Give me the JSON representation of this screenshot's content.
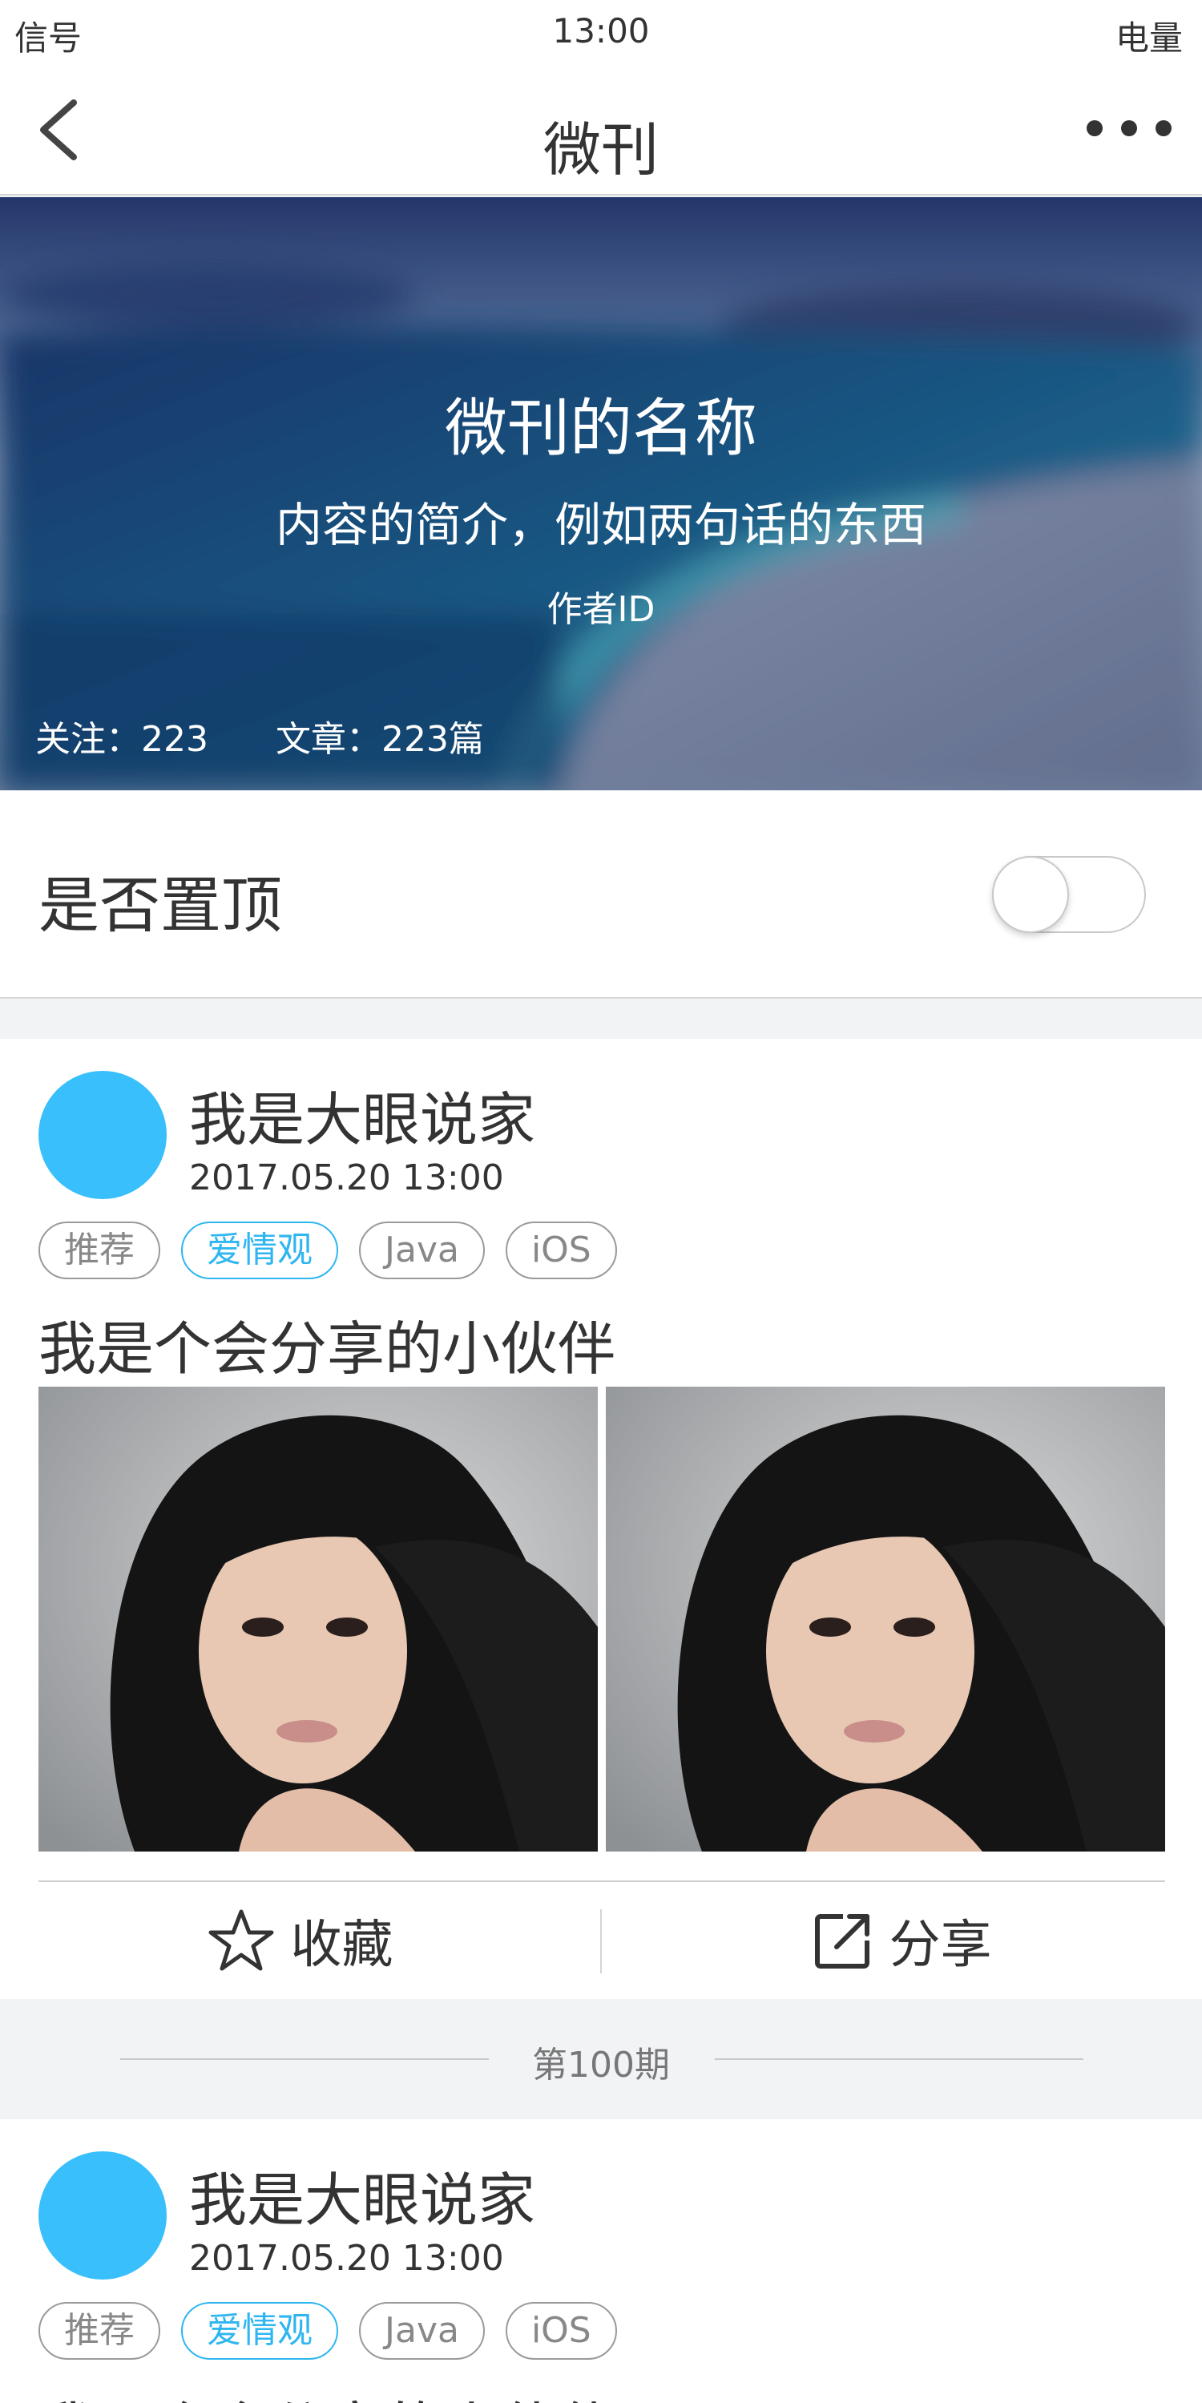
{
  "status_bar": {
    "signal": "信号",
    "time": "13:00",
    "battery": "电量"
  },
  "nav": {
    "title": "微刊",
    "back_icon": "chevron-left-icon",
    "more_icon": "more-dots-icon"
  },
  "banner": {
    "name": "微刊的名称",
    "intro": "内容的简介，例如两句话的东西",
    "author": "作者ID",
    "follow": "关注：223",
    "articles": "文章：223篇"
  },
  "pin": {
    "label": "是否置顶",
    "enabled": false
  },
  "posts": [
    {
      "author": "我是大眼说家",
      "time": "2017.05.20   13:00",
      "tags": [
        {
          "label": "推荐",
          "active": false
        },
        {
          "label": "爱情观",
          "active": true
        },
        {
          "label": "Java",
          "active": false
        },
        {
          "label": "iOS",
          "active": false
        }
      ],
      "text": "我是个会分享的小伙伴",
      "actions": {
        "collect": "收藏",
        "share": "分享"
      }
    },
    {
      "author": "我是大眼说家",
      "time": "2017.05.20   13:00",
      "tags": [
        {
          "label": "推荐",
          "active": false
        },
        {
          "label": "爱情观",
          "active": true
        },
        {
          "label": "Java",
          "active": false
        },
        {
          "label": "iOS",
          "active": false
        }
      ],
      "text": "我是个会分享的小伙伴"
    }
  ],
  "issue_label": "第100期",
  "colors": {
    "accent": "#2fb6f0",
    "avatar": "#39bffb",
    "background": "#f2f3f5"
  }
}
